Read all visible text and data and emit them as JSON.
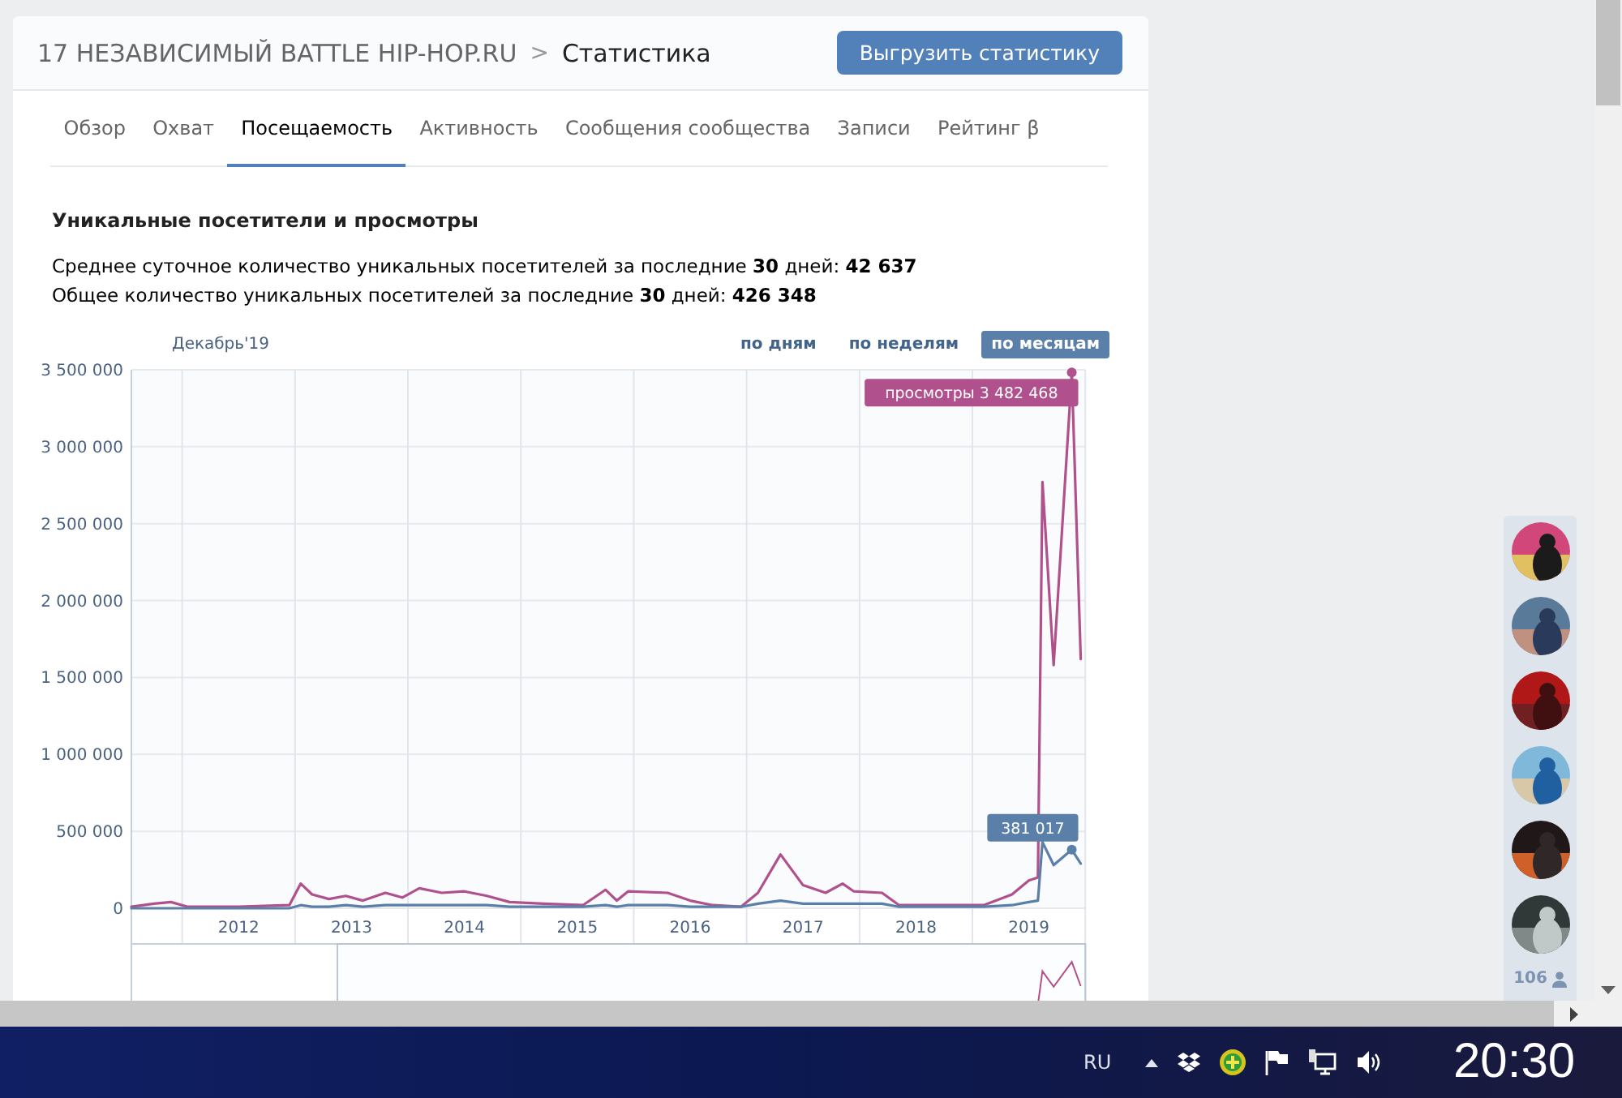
{
  "header": {
    "breadcrumb": "17 НЕЗАВИСИМЫЙ BATTLE HIP-HOP.RU",
    "separator": ">",
    "title": "Статистика",
    "export_button": "Выгрузить статистику"
  },
  "tabs": [
    {
      "label": "Обзор",
      "selected": false
    },
    {
      "label": "Охват",
      "selected": false
    },
    {
      "label": "Посещаемость",
      "selected": true
    },
    {
      "label": "Активность",
      "selected": false
    },
    {
      "label": "Сообщения сообщества",
      "selected": false
    },
    {
      "label": "Записи",
      "selected": false
    },
    {
      "label": "Рейтинг β",
      "selected": false
    }
  ],
  "section": {
    "title": "Уникальные посетители и просмотры",
    "stats": [
      "Среднее суточное количество уникальных посетителей за последние **30** дней: **42 637**",
      "Общее количество уникальных посетителей за последние **30** дней: **426 348**"
    ],
    "period_label": "Декабрь'19",
    "periods": [
      {
        "label": "по дням",
        "selected": false
      },
      {
        "label": "по неделям",
        "selected": false
      },
      {
        "label": "по месяцам",
        "selected": true
      }
    ],
    "chart_data": {
      "type": "line",
      "x": [
        2011.55,
        2011.75,
        2011.9,
        2012.05,
        2012.5,
        2012.95,
        2013.05,
        2013.15,
        2013.3,
        2013.45,
        2013.6,
        2013.8,
        2013.95,
        2014.1,
        2014.3,
        2014.5,
        2014.7,
        2014.9,
        2015.2,
        2015.55,
        2015.75,
        2015.85,
        2015.95,
        2016.3,
        2016.5,
        2016.7,
        2016.95,
        2017.1,
        2017.3,
        2017.5,
        2017.7,
        2017.85,
        2017.95,
        2018.2,
        2018.35,
        2018.8,
        2019.1,
        2019.35,
        2019.5,
        2019.58,
        2019.62,
        2019.72,
        2019.88,
        2019.96
      ],
      "series": [
        {
          "color": "#b0508c",
          "values": [
            10000,
            30000,
            40000,
            10000,
            10000,
            20000,
            160000,
            90000,
            60000,
            80000,
            50000,
            100000,
            70000,
            130000,
            100000,
            110000,
            80000,
            40000,
            30000,
            20000,
            120000,
            50000,
            110000,
            100000,
            50000,
            20000,
            10000,
            100000,
            350000,
            150000,
            100000,
            160000,
            110000,
            100000,
            20000,
            20000,
            20000,
            90000,
            180000,
            200000,
            2770000,
            1580000,
            3482468,
            1620000
          ]
        },
        {
          "color": "#5a7fa8",
          "values": [
            0,
            0,
            0,
            0,
            0,
            0,
            20000,
            10000,
            10000,
            20000,
            10000,
            20000,
            20000,
            20000,
            20000,
            20000,
            20000,
            10000,
            10000,
            10000,
            20000,
            10000,
            20000,
            20000,
            10000,
            10000,
            10000,
            30000,
            50000,
            30000,
            30000,
            30000,
            30000,
            30000,
            10000,
            10000,
            10000,
            20000,
            40000,
            50000,
            430000,
            280000,
            381017,
            290000
          ]
        }
      ],
      "grid": true,
      "xlim": [
        2011.55,
        2020
      ],
      "ylim": [
        0,
        3500000
      ],
      "xticks": [
        {
          "value": 2012.5,
          "label": "2012"
        },
        {
          "value": 2013.5,
          "label": "2013"
        },
        {
          "value": 2014.5,
          "label": "2014"
        },
        {
          "value": 2015.5,
          "label": "2015"
        },
        {
          "value": 2016.5,
          "label": "2016"
        },
        {
          "value": 2017.5,
          "label": "2017"
        },
        {
          "value": 2018.5,
          "label": "2018"
        },
        {
          "value": 2019.5,
          "label": "2019"
        }
      ],
      "yticks": [
        {
          "value": 0,
          "label": "0"
        },
        {
          "value": 500000,
          "label": "500 000"
        },
        {
          "value": 1000000,
          "label": "1 000 000"
        },
        {
          "value": 1500000,
          "label": "1 500 000"
        },
        {
          "value": 2000000,
          "label": "2 000 000"
        },
        {
          "value": 2500000,
          "label": "2 500 000"
        },
        {
          "value": 3000000,
          "label": "3 000 000"
        },
        {
          "value": 3500000,
          "label": "3 500 000"
        }
      ],
      "annotations": [
        {
          "x": 2019.88,
          "y": 3482468,
          "text": "просмотры 3 482 468"
        },
        {
          "x": 2019.88,
          "y": 381017,
          "text": "381 017"
        }
      ]
    }
  },
  "online_panel": {
    "count": "106"
  },
  "taskbar": {
    "language": "RU",
    "time": "20:30"
  }
}
